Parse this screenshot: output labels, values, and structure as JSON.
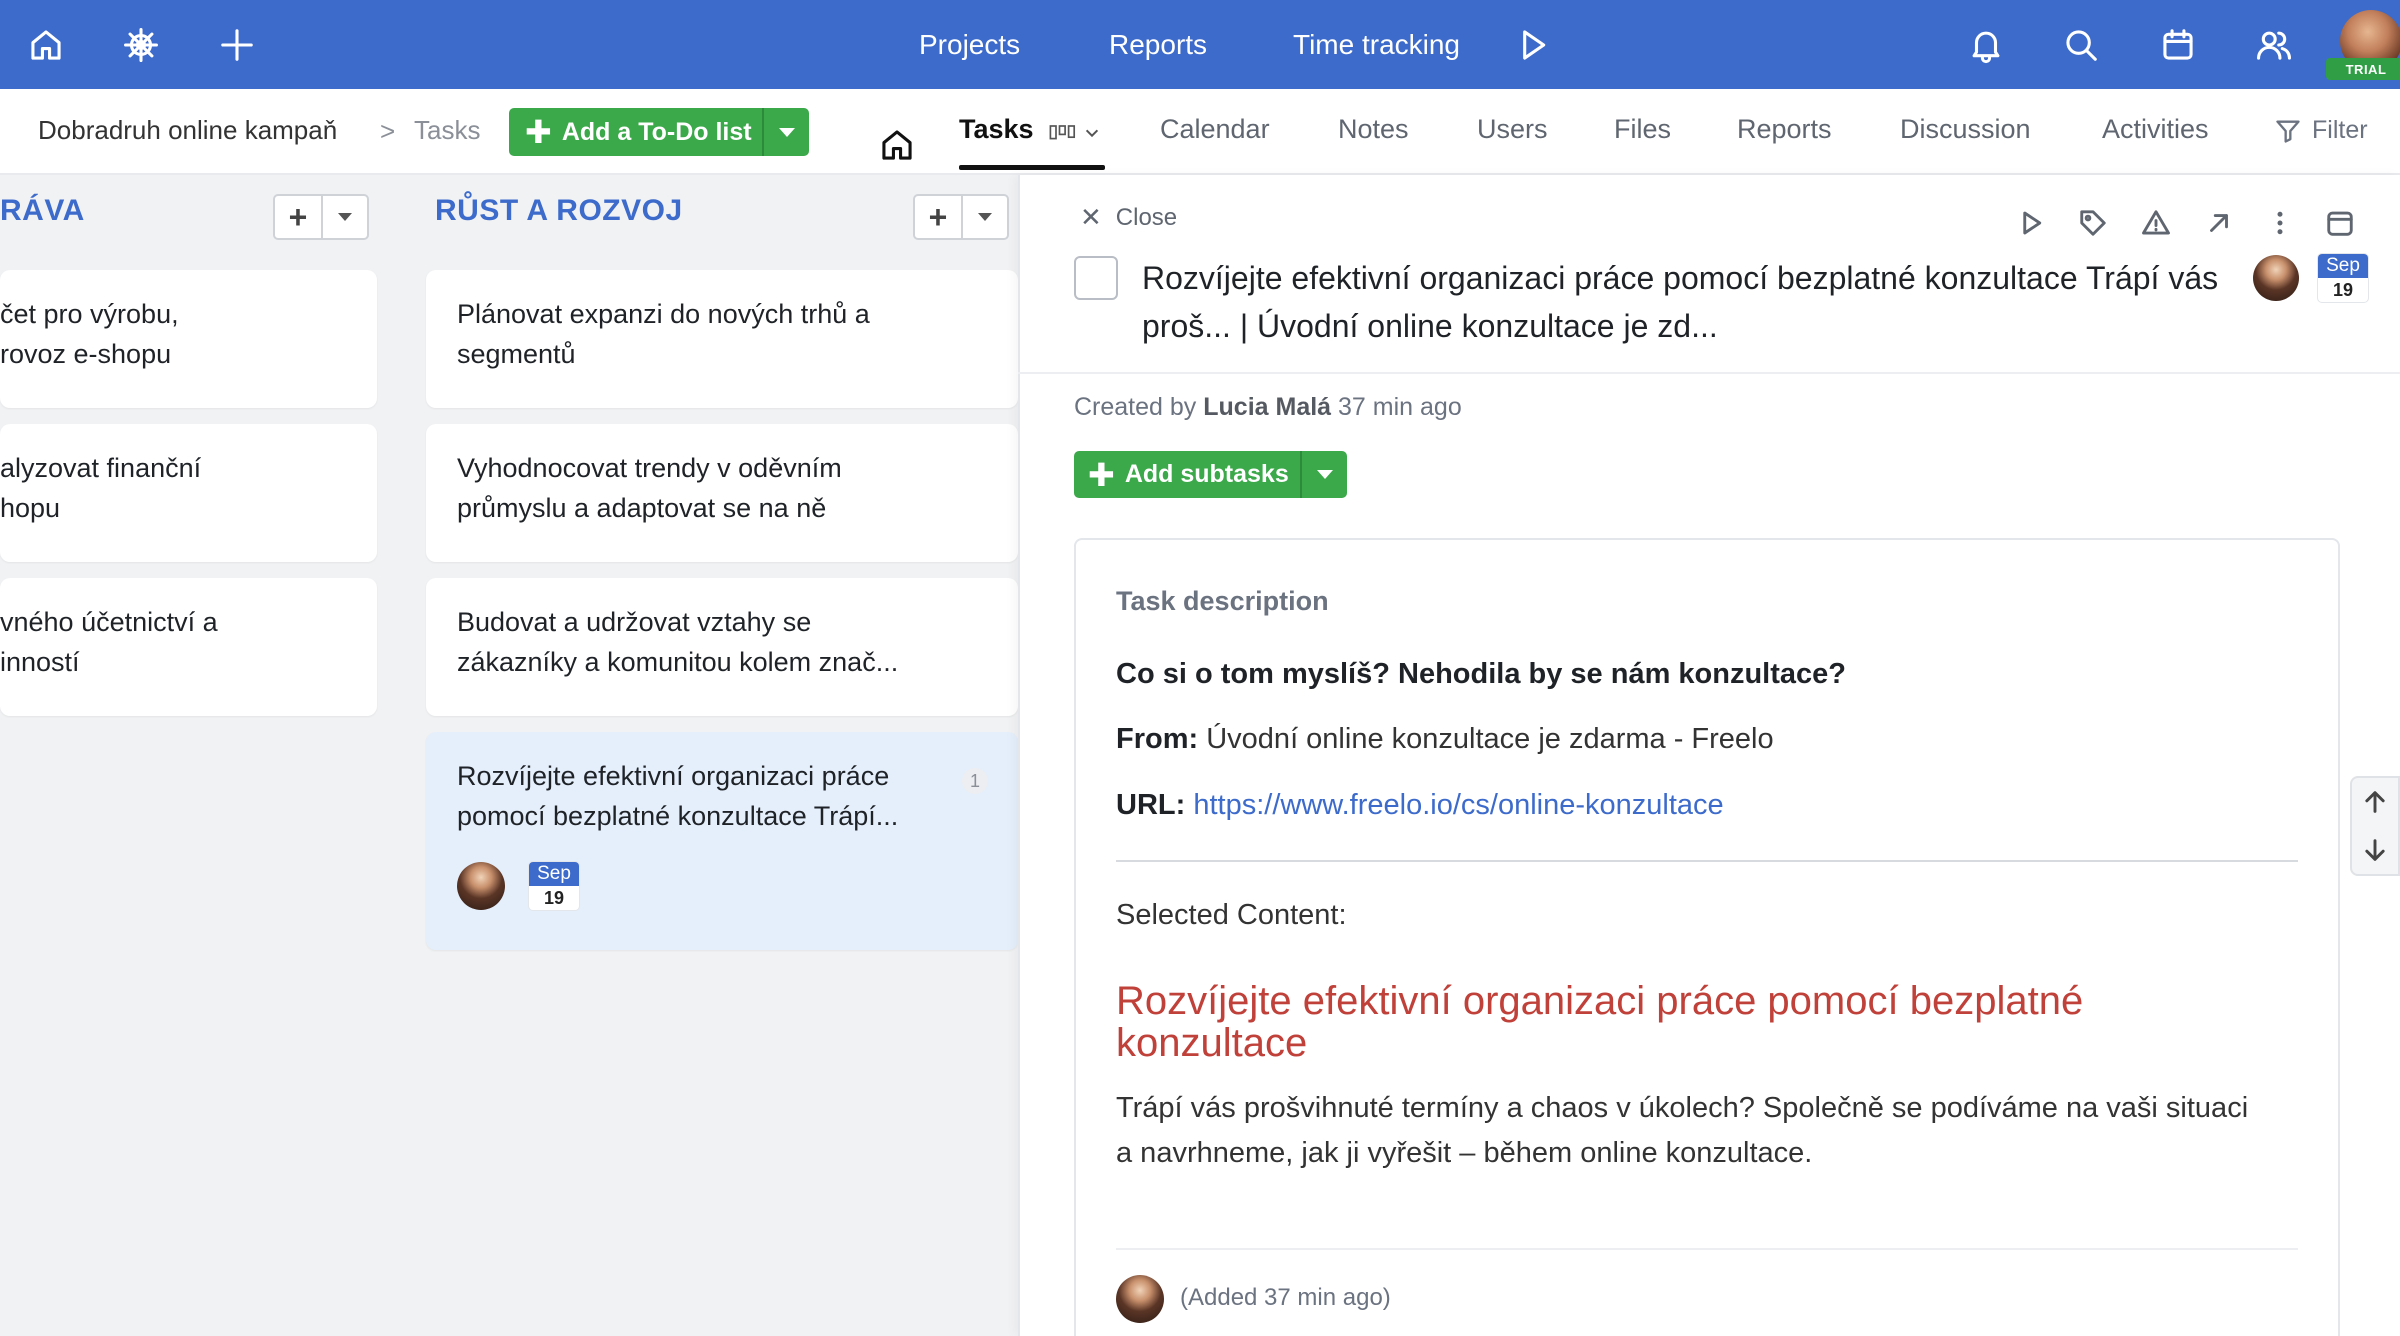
{
  "topbar": {
    "nav": [
      "Projects",
      "Reports",
      "Time tracking"
    ],
    "trial_badge": "TRIAL",
    "color": "#3d6bcb"
  },
  "breadcrumb": {
    "project": "Dobradruh online kampaň",
    "separator": ">",
    "current": "Tasks"
  },
  "add_todo_list_label": "Add a To-Do list",
  "tabs": [
    "Tasks",
    "Calendar",
    "Notes",
    "Users",
    "Files",
    "Reports",
    "Discussion",
    "Activities"
  ],
  "filter_label": "Filter",
  "columns": [
    {
      "title": "RÁVA",
      "cards": [
        {
          "line1": "čet pro výrobu,",
          "line2": "rovoz e-shopu"
        },
        {
          "line1": "alyzovat finanční",
          "line2": "hopu"
        },
        {
          "line1": "vného účetnictví a",
          "line2": "inností"
        }
      ]
    },
    {
      "title": "RŮST A ROZVOJ",
      "cards": [
        {
          "line1": "Plánovat expanzi do nových trhů a",
          "line2": "segmentů"
        },
        {
          "line1": "Vyhodnocovat trendy v oděvním",
          "line2": "průmyslu a adaptovat se na ně"
        },
        {
          "line1": "Budovat a udržovat vztahy se",
          "line2": "zákazníky a komunitou kolem znač..."
        },
        {
          "line1": "Rozvíjejte efektivní organizaci práce",
          "line2": "pomocí bezplatné konzultace Trápí...",
          "count": "1",
          "date_month": "Sep",
          "date_day": "19"
        }
      ]
    }
  ],
  "detail": {
    "close_label": "Close",
    "title_line1": "Rozvíjejte efektivní organizaci práce pomocí bezplatné konzultace Trápí vás",
    "title_line2": "proš... | Úvodní online konzultace je zd...",
    "date_month": "Sep",
    "date_day": "19",
    "created_prefix": "Created by",
    "created_by": "Lucia Malá",
    "created_ago": "37 min ago",
    "add_subtasks_label": "Add subtasks",
    "description_label": "Task description",
    "question": "Co si o tom myslíš? Nehodila by se nám konzultace?",
    "from_label": "From:",
    "from_value": "Úvodní online konzultace je zdarma - Freelo",
    "url_label": "URL:",
    "url_value": "https://www.freelo.io/cs/online-konzultace",
    "selected_label": "Selected Content:",
    "heading": "Rozvíjejte efektivní organizaci práce pomocí bezplatné konzultace",
    "paragraph": "Trápí vás prošvihnuté termíny a chaos v úkolech? Společně se podíváme na vaši situaci a navrhneme, jak ji vyřešit – během online konzultace.",
    "added_note": "(Added 37 min ago)"
  }
}
